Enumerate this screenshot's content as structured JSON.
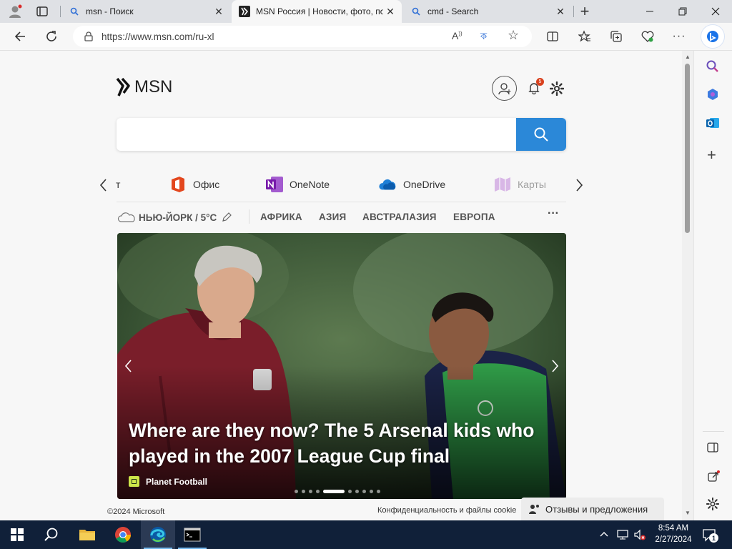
{
  "tabs": [
    {
      "title": "msn - Поиск",
      "active": false
    },
    {
      "title": "MSN Россия | Новости, фото, по",
      "active": true
    },
    {
      "title": "cmd - Search",
      "active": false
    }
  ],
  "address": {
    "url": "https://www.msn.com/ru-xl"
  },
  "msn": {
    "logo_text": "MSN",
    "notification_count": "5",
    "search_placeholder": ""
  },
  "shortcuts": [
    {
      "label": "т",
      "icon": "partial-icon"
    },
    {
      "label": "Офис",
      "icon": "office-icon"
    },
    {
      "label": "OneNote",
      "icon": "onenote-icon"
    },
    {
      "label": "OneDrive",
      "icon": "onedrive-icon"
    },
    {
      "label": "Карты",
      "icon": "maps-icon"
    }
  ],
  "nav": {
    "weather": "НЬЮ-ЙОРК / 5°C",
    "links": [
      "АФРИКА",
      "АЗИЯ",
      "АВСТРАЛАЗИЯ",
      "ЕВРОПА"
    ],
    "more": "···"
  },
  "hero": {
    "headline": "Where are they now? The 5 Arsenal kids who played in the 2007 League Cup final",
    "source": "Planet Football",
    "dots_count": 10,
    "active_dot": 4
  },
  "footer": {
    "copyright": "©2024 Microsoft",
    "privacy": "Конфиденциальность и файлы cookie",
    "feedback": "Отзывы и предложения"
  },
  "clock": {
    "time": "8:54 AM",
    "date": "2/27/2024"
  },
  "notifications_badge": "1"
}
